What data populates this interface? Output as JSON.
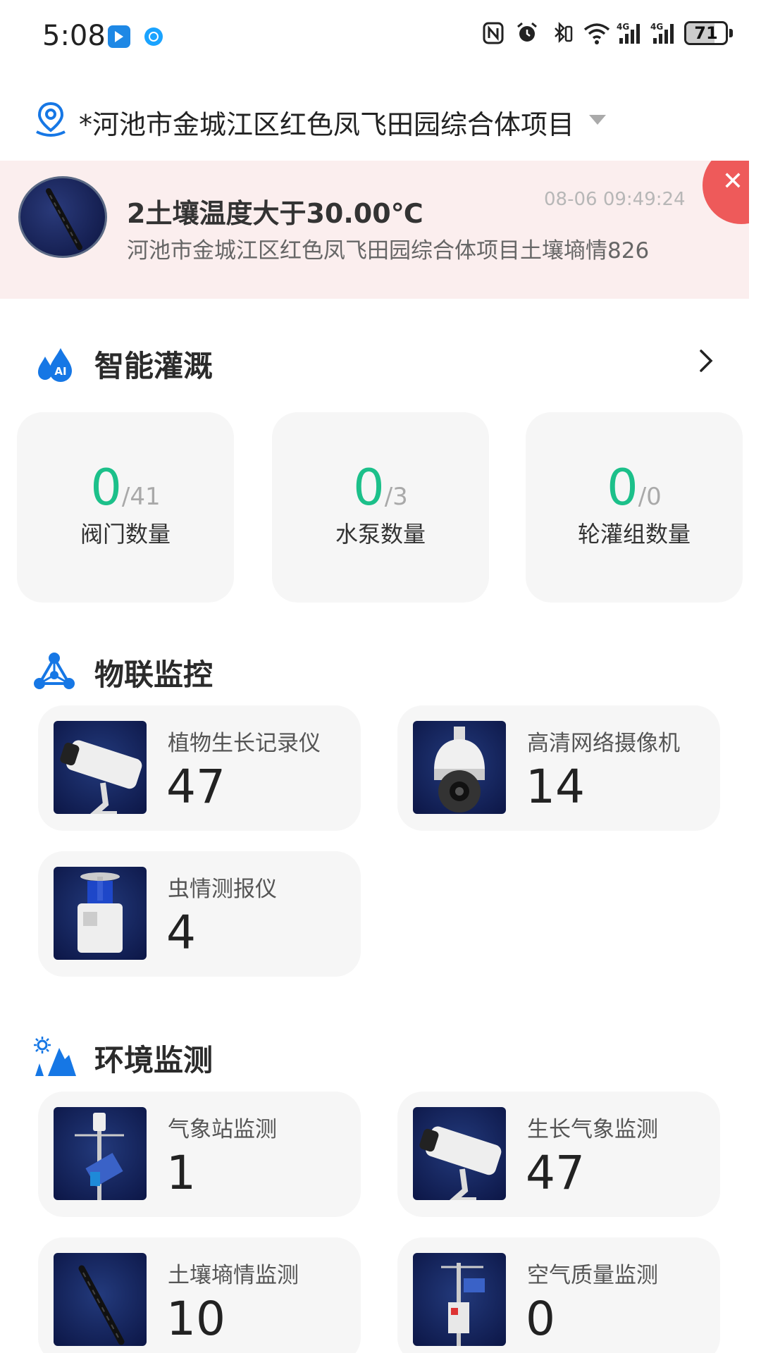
{
  "status_bar": {
    "time": "5:08",
    "battery_level": "71",
    "battery_fraction": 0.71,
    "icons": [
      "nfc-icon",
      "alarm-icon",
      "bluetooth-icon",
      "wifi-icon",
      "signal-4g-icon",
      "signal-4g-icon"
    ]
  },
  "project": {
    "name": "*河池市金城江区红色凤飞田园综合体项目"
  },
  "alert": {
    "title": "2土壤温度大于30.00℃",
    "time": "08-06 09:49:24",
    "subtitle": "河池市金城江区红色凤飞田园综合体项目土壤墒情826"
  },
  "irrigation": {
    "title": "智能灌溉",
    "cards": [
      {
        "value": "0",
        "total": "/41",
        "label": "阀门数量"
      },
      {
        "value": "0",
        "total": "/3",
        "label": "水泵数量"
      },
      {
        "value": "0",
        "total": "/0",
        "label": "轮灌组数量"
      }
    ]
  },
  "iot": {
    "title": "物联监控",
    "devices": [
      {
        "name": "植物生长记录仪",
        "count": "47",
        "image": "bullet-camera"
      },
      {
        "name": "高清网络摄像机",
        "count": "14",
        "image": "dome-camera"
      },
      {
        "name": "虫情测报仪",
        "count": "4",
        "image": "insect-trap"
      }
    ]
  },
  "env": {
    "title": "环境监测",
    "devices": [
      {
        "name": "气象站监测",
        "count": "1",
        "image": "weather-station"
      },
      {
        "name": "生长气象监测",
        "count": "47",
        "image": "bullet-camera"
      },
      {
        "name": "土壤墒情监测",
        "count": "10",
        "image": "soil-probe"
      },
      {
        "name": "空气质量监测",
        "count": "0",
        "image": "air-station"
      }
    ]
  },
  "colors": {
    "accent_green": "#1cc08a",
    "accent_blue": "#1677e5",
    "alert_bg": "#fbeeee",
    "close_red": "#ee5a5a",
    "card_bg": "#f6f6f6"
  }
}
